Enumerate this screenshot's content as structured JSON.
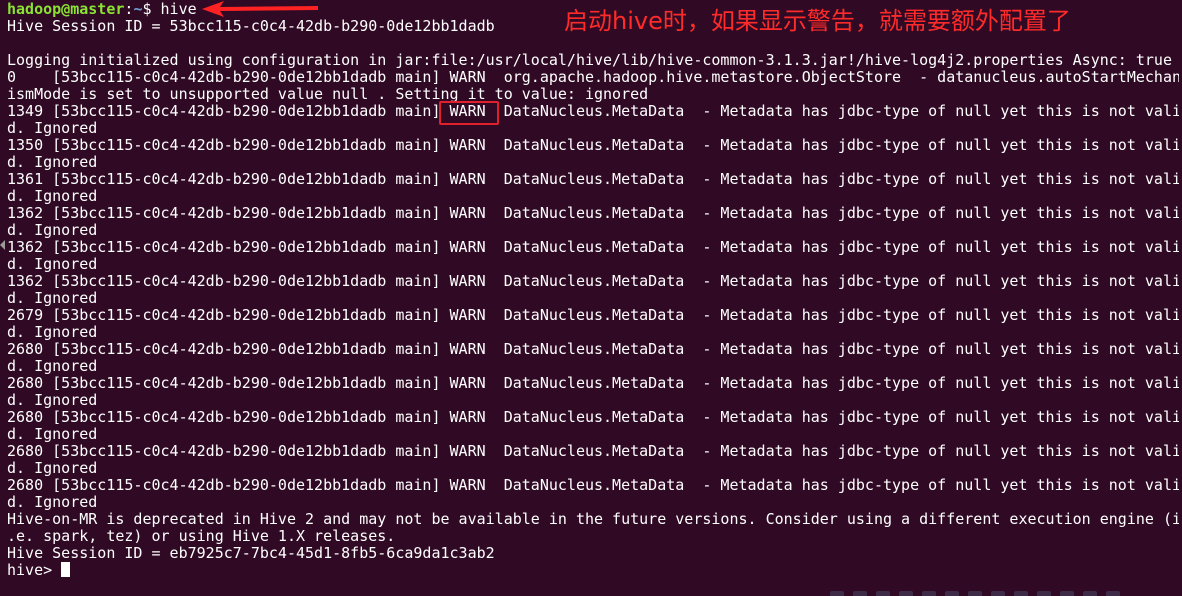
{
  "terminal": {
    "prompt": {
      "user_host": "hadoop@master",
      "separator": ":",
      "path": "~",
      "symbol": "$ ",
      "command": "hive"
    },
    "lines": [
      "Hive Session ID = 53bcc115-c0c4-42db-b290-0de12bb1dadb",
      "",
      "Logging initialized using configuration in jar:file:/usr/local/hive/lib/hive-common-3.1.3.jar!/hive-log4j2.properties Async: true",
      "0    [53bcc115-c0c4-42db-b290-0de12bb1dadb main] WARN  org.apache.hadoop.hive.metastore.ObjectStore  - datanucleus.autoStartMechan",
      "ismMode is set to unsupported value null . Setting it to value: ignored",
      "1349 [53bcc115-c0c4-42db-b290-0de12bb1dadb main] WARN  DataNucleus.MetaData  - Metadata has jdbc-type of null yet this is not vali",
      "d. Ignored",
      "1350 [53bcc115-c0c4-42db-b290-0de12bb1dadb main] WARN  DataNucleus.MetaData  - Metadata has jdbc-type of null yet this is not vali",
      "d. Ignored",
      "1361 [53bcc115-c0c4-42db-b290-0de12bb1dadb main] WARN  DataNucleus.MetaData  - Metadata has jdbc-type of null yet this is not vali",
      "d. Ignored",
      "1362 [53bcc115-c0c4-42db-b290-0de12bb1dadb main] WARN  DataNucleus.MetaData  - Metadata has jdbc-type of null yet this is not vali",
      "d. Ignored",
      "1362 [53bcc115-c0c4-42db-b290-0de12bb1dadb main] WARN  DataNucleus.MetaData  - Metadata has jdbc-type of null yet this is not vali",
      "d. Ignored",
      "1362 [53bcc115-c0c4-42db-b290-0de12bb1dadb main] WARN  DataNucleus.MetaData  - Metadata has jdbc-type of null yet this is not vali",
      "d. Ignored",
      "2679 [53bcc115-c0c4-42db-b290-0de12bb1dadb main] WARN  DataNucleus.MetaData  - Metadata has jdbc-type of null yet this is not vali",
      "d. Ignored",
      "2680 [53bcc115-c0c4-42db-b290-0de12bb1dadb main] WARN  DataNucleus.MetaData  - Metadata has jdbc-type of null yet this is not vali",
      "d. Ignored",
      "2680 [53bcc115-c0c4-42db-b290-0de12bb1dadb main] WARN  DataNucleus.MetaData  - Metadata has jdbc-type of null yet this is not vali",
      "d. Ignored",
      "2680 [53bcc115-c0c4-42db-b290-0de12bb1dadb main] WARN  DataNucleus.MetaData  - Metadata has jdbc-type of null yet this is not vali",
      "d. Ignored",
      "2680 [53bcc115-c0c4-42db-b290-0de12bb1dadb main] WARN  DataNucleus.MetaData  - Metadata has jdbc-type of null yet this is not vali",
      "d. Ignored",
      "2680 [53bcc115-c0c4-42db-b290-0de12bb1dadb main] WARN  DataNucleus.MetaData  - Metadata has jdbc-type of null yet this is not vali",
      "d. Ignored",
      "Hive-on-MR is deprecated in Hive 2 and may not be available in the future versions. Consider using a different execution engine (i",
      ".e. spark, tez) or using Hive 1.X releases.",
      "Hive Session ID = eb7925c7-7bc4-45d1-8fb5-6ca9da1c3ab2"
    ],
    "final_prompt": "hive> "
  },
  "annotation": {
    "text": "启动hive时，如果显示警告，就需要额外配置了",
    "color": "#ff2a2a"
  },
  "colors": {
    "background": "#300a24",
    "foreground": "#ffffff",
    "prompt_user": "#8ae234",
    "prompt_path": "#729fcf",
    "highlight_box": "#e0202a"
  },
  "icons": {
    "arrow": "red-arrow-icon",
    "highlight": "warn-highlight-box",
    "cursor": "block-cursor"
  }
}
